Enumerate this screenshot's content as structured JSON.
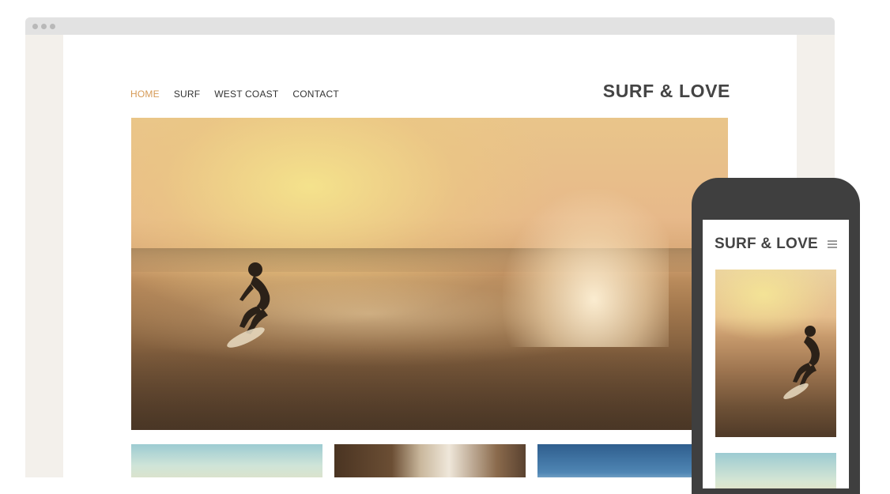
{
  "desktop": {
    "nav": [
      {
        "label": "HOME",
        "active": true
      },
      {
        "label": "SURF",
        "active": false
      },
      {
        "label": "WEST COAST",
        "active": false
      },
      {
        "label": "CONTACT",
        "active": false
      }
    ],
    "brand": "SURF & LOVE"
  },
  "mobile": {
    "brand": "SURF & LOVE",
    "menu_icon": "hamburger-menu-icon"
  },
  "colors": {
    "accent": "#d69a56",
    "text": "#333333",
    "brand_text": "#444444",
    "phone_frame": "#3f3f3f",
    "page_bg": "#f3f0eb"
  }
}
